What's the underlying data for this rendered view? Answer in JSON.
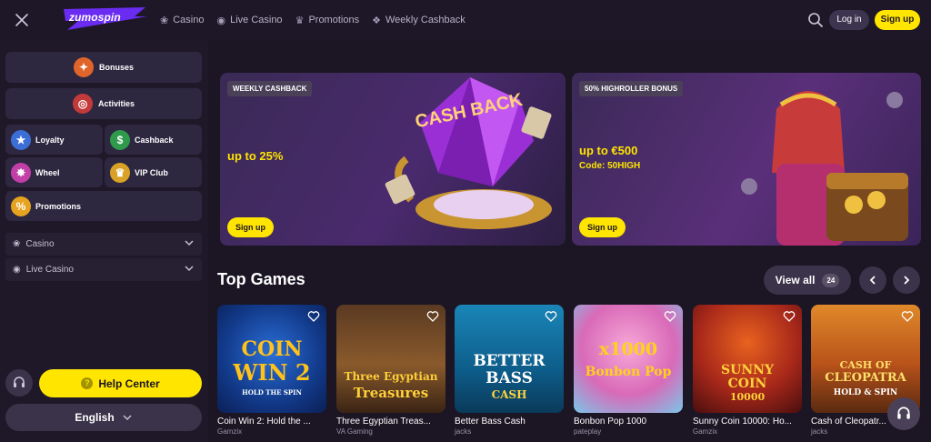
{
  "header": {
    "brand": "zumospin",
    "nav": [
      {
        "label": "Casino",
        "icon": "cherry-icon"
      },
      {
        "label": "Live Casino",
        "icon": "live-icon"
      },
      {
        "label": "Promotions",
        "icon": "crown-icon"
      },
      {
        "label": "Weekly Cashback",
        "icon": "gift-icon"
      }
    ],
    "login_label": "Log in",
    "signup_label": "Sign up"
  },
  "sidebar": {
    "bonuses": "Bonuses",
    "activities": "Activities",
    "loyalty": "Loyalty",
    "cashback": "Cashback",
    "wheel": "Wheel",
    "vip": "VIP Club",
    "promotions": "Promotions",
    "casino": "Casino",
    "live_casino": "Live Casino",
    "help_label": "Help Center",
    "language": "English"
  },
  "banners": [
    {
      "tag": "WEEKLY CASHBACK",
      "offer": "up to 25%",
      "code": "",
      "button": "Sign up",
      "art_text": "CASH BACK"
    },
    {
      "tag": "50% HIGHROLLER BONUS",
      "offer": "up to €500",
      "code": "Code: 50HIGH",
      "button": "Sign up"
    }
  ],
  "top_games": {
    "title": "Top Games",
    "view_all": "View all",
    "count": "24",
    "games": [
      {
        "name": "Coin Win 2: Hold the ...",
        "provider": "Gamzix",
        "art": [
          "COIN",
          "WIN 2",
          "HOLD THE SPIN"
        ]
      },
      {
        "name": "Three Egyptian Treas...",
        "provider": "VA Gaming",
        "art": [
          "Three Egyptian",
          "Treasures"
        ]
      },
      {
        "name": "Better Bass Cash",
        "provider": "jacks",
        "art": [
          "BETTER",
          "BASS",
          "CASH"
        ]
      },
      {
        "name": "Bonbon Pop 1000",
        "provider": "pateplay",
        "art": [
          "x1000",
          "Bonbon Pop"
        ]
      },
      {
        "name": "Sunny Coin 10000: Ho...",
        "provider": "Gamzix",
        "art": [
          "SUNNY",
          "COIN",
          "10000"
        ]
      },
      {
        "name": "Cash of Cleopatr...",
        "provider": "jacks",
        "art": [
          "CASH OF",
          "CLEOPATRA",
          "HOLD & SPIN"
        ]
      }
    ]
  }
}
